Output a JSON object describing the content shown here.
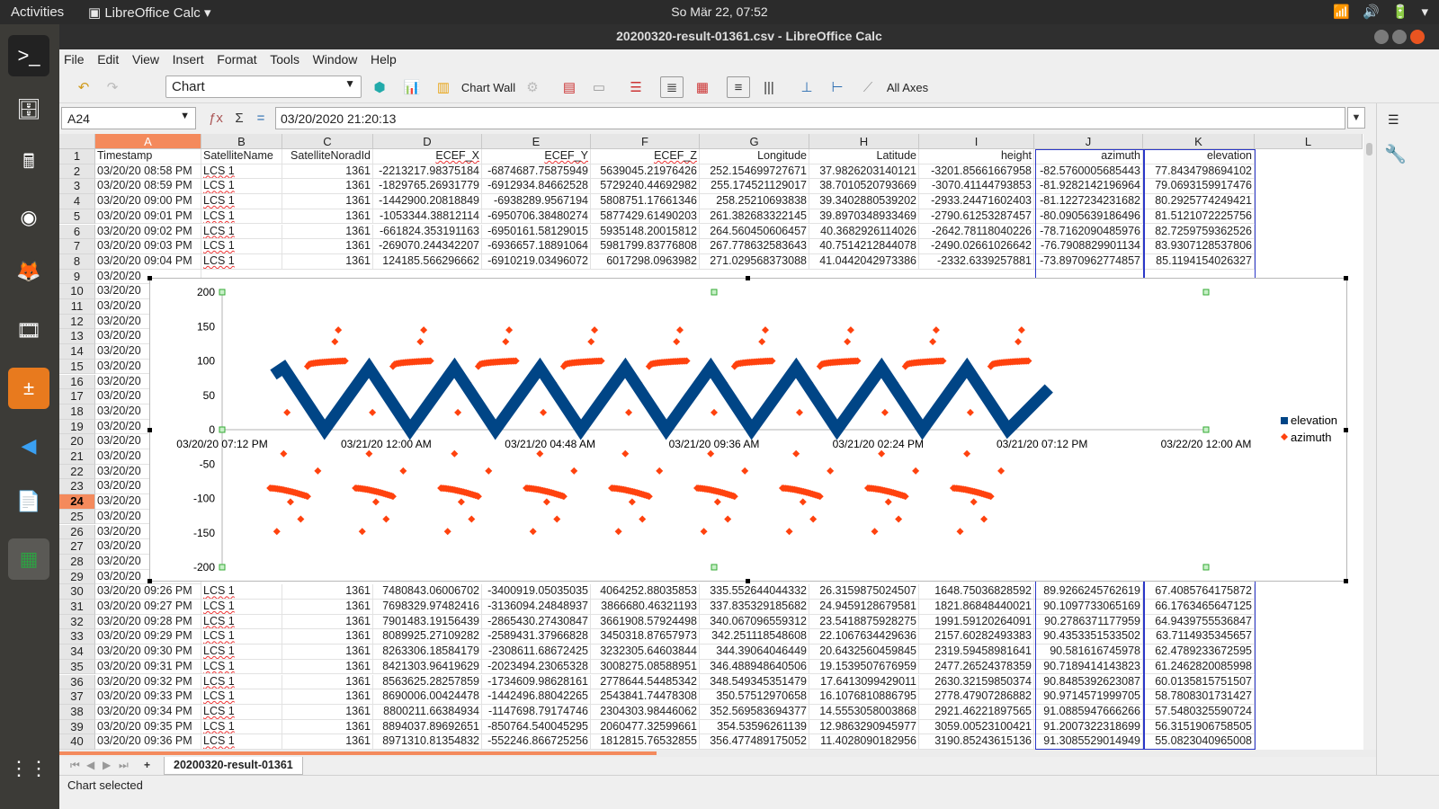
{
  "topbar": {
    "activities": "Activities",
    "app_name": "LibreOffice Calc",
    "clock": "So Mär 22, 07:52"
  },
  "window": {
    "title": "20200320-result-01361.csv - LibreOffice Calc"
  },
  "menu": [
    "File",
    "Edit",
    "View",
    "Insert",
    "Format",
    "Tools",
    "Window",
    "Help"
  ],
  "toolbar": {
    "chart_selector": "Chart",
    "chart_wall_label": "Chart Wall",
    "all_axes_label": "All Axes"
  },
  "formula": {
    "name_box": "A24",
    "content": "03/20/2020 21:20:13"
  },
  "columns": [
    "A",
    "B",
    "C",
    "D",
    "E",
    "F",
    "G",
    "H",
    "I",
    "J",
    "K",
    "L"
  ],
  "visible_rows": [
    1,
    2,
    3,
    4,
    5,
    6,
    7,
    8,
    9,
    10,
    11,
    12,
    13,
    14,
    15,
    16,
    17,
    18,
    19,
    20,
    21,
    22,
    23,
    24,
    25,
    26,
    27,
    28,
    29,
    30,
    31,
    32,
    33,
    34,
    35,
    36,
    37,
    38,
    39,
    40
  ],
  "headers": [
    "Timestamp",
    "SatelliteName",
    "SatelliteNoradId",
    "ECEF_X",
    "ECEF_Y",
    "ECEF_Z",
    "Longitude",
    "Latitude",
    "height",
    "azimuth",
    "elevation"
  ],
  "rows_top": [
    [
      "03/20/20 08:58 PM",
      "LCS 1",
      "1361",
      "-2213217.98375184",
      "-6874687.75875949",
      "5639045.21976426",
      "252.154699727671",
      "37.9826203140121",
      "-3201.85661667958",
      "-82.5760005685443",
      "77.8434798694102"
    ],
    [
      "03/20/20 08:59 PM",
      "LCS 1",
      "1361",
      "-1829765.26931779",
      "-6912934.84662528",
      "5729240.44692982",
      "255.174521129017",
      "38.7010520793669",
      "-3070.41144793853",
      "-81.9282142196964",
      "79.0693159917476"
    ],
    [
      "03/20/20 09:00 PM",
      "LCS 1",
      "1361",
      "-1442900.20818849",
      "-6938289.9567194",
      "5808751.17661346",
      "258.25210693838",
      "39.3402880539202",
      "-2933.24471602403",
      "-81.1227234231682",
      "80.2925774249421"
    ],
    [
      "03/20/20 09:01 PM",
      "LCS 1",
      "1361",
      "-1053344.38812114",
      "-6950706.38480274",
      "5877429.61490203",
      "261.382683322145",
      "39.8970348933469",
      "-2790.61253287457",
      "-80.0905639186496",
      "81.5121072225756"
    ],
    [
      "03/20/20 09:02 PM",
      "LCS 1",
      "1361",
      "-661824.353191163",
      "-6950161.58129015",
      "5935148.20015812",
      "264.560450606457",
      "40.3682926114026",
      "-2642.78118040226",
      "-78.7162090485976",
      "82.7259759362526"
    ],
    [
      "03/20/20 09:03 PM",
      "LCS 1",
      "1361",
      "-269070.244342207",
      "-6936657.18891064",
      "5981799.83776808",
      "267.778632583643",
      "40.7514212844078",
      "-2490.02661026642",
      "-76.7908829901134",
      "83.9307128537806"
    ],
    [
      "03/20/20 09:04 PM",
      "LCS 1",
      "1361",
      "124185.566296662",
      "-6910219.03496072",
      "6017298.0963982",
      "271.029568373088",
      "41.0442042973386",
      "-2332.6339257881",
      "-73.8970962774857",
      "85.1194154026327"
    ]
  ],
  "rows_hidden_timestamps": [
    "03/20/20",
    "03/20/20",
    "03/20/20",
    "03/20/20",
    "03/20/20",
    "03/20/20",
    "03/20/20",
    "03/20/20",
    "03/20/20",
    "03/20/20",
    "03/20/20",
    "03/20/20",
    "03/20/20",
    "03/20/20",
    "03/20/20",
    "03/20/20",
    "03/20/20",
    "03/20/20",
    "03/20/20",
    "03/20/20",
    "03/20/20"
  ],
  "rows_bottom": [
    [
      "03/20/20 09:26 PM",
      "LCS 1",
      "1361",
      "7480843.06006702",
      "-3400919.05035035",
      "4064252.88035853",
      "335.552644044332",
      "26.3159875024507",
      "1648.75036828592",
      "89.9266245762619",
      "67.4085764175872"
    ],
    [
      "03/20/20 09:27 PM",
      "LCS 1",
      "1361",
      "7698329.97482416",
      "-3136094.24848937",
      "3866680.46321193",
      "337.835329185682",
      "24.9459128679581",
      "1821.86848440021",
      "90.1097733065169",
      "66.1763465647125"
    ],
    [
      "03/20/20 09:28 PM",
      "LCS 1",
      "1361",
      "7901483.19156439",
      "-2865430.27430847",
      "3661908.57924498",
      "340.067096559312",
      "23.5418875928275",
      "1991.59120264091",
      "90.2786371177959",
      "64.9439755536847"
    ],
    [
      "03/20/20 09:29 PM",
      "LCS 1",
      "1361",
      "8089925.27109282",
      "-2589431.37966828",
      "3450318.87657973",
      "342.251118548608",
      "22.1067634429636",
      "2157.60282493383",
      "90.4353351533502",
      "63.7114935345657"
    ],
    [
      "03/20/20 09:30 PM",
      "LCS 1",
      "1361",
      "8263306.18584179",
      "-2308611.68672425",
      "3232305.64603844",
      "344.39064046449",
      "20.6432560459845",
      "2319.59458981641",
      "90.581616745978",
      "62.4789233672595"
    ],
    [
      "03/20/20 09:31 PM",
      "LCS 1",
      "1361",
      "8421303.96419629",
      "-2023494.23065328",
      "3008275.08588951",
      "346.488948640506",
      "19.1539507676959",
      "2477.26524378359",
      "90.7189414143823",
      "61.2462820085998"
    ],
    [
      "03/20/20 09:32 PM",
      "LCS 1",
      "1361",
      "8563625.28257859",
      "-1734609.98628161",
      "2778644.54485342",
      "348.549345351479",
      "17.6413099429011",
      "2630.32159850374",
      "90.8485392623087",
      "60.0135815751507"
    ],
    [
      "03/20/20 09:33 PM",
      "LCS 1",
      "1361",
      "8690006.00424478",
      "-1442496.88042265",
      "2543841.74478308",
      "350.57512970658",
      "16.1076810886795",
      "2778.47907286882",
      "90.9714571999705",
      "58.7808301731427"
    ],
    [
      "03/20/20 09:34 PM",
      "LCS 1",
      "1361",
      "8800211.66384934",
      "-1147698.79174746",
      "2304303.98446062",
      "352.569583694377",
      "14.5553058003868",
      "2921.46221897565",
      "91.0885947666266",
      "57.5480325590724"
    ],
    [
      "03/20/20 09:35 PM",
      "LCS 1",
      "1361",
      "8894037.89692651",
      "-850764.540045295",
      "2060477.32599661",
      "354.53596261139",
      "12.9863290945977",
      "3059.00523100421",
      "91.2007322318699",
      "56.3151906758505"
    ],
    [
      "03/20/20 09:36 PM",
      "LCS 1",
      "1361",
      "8971310.81354832",
      "-552246.866725256",
      "1812815.76532855",
      "356.477489175052",
      "11.4028090182956",
      "3190.85243615136",
      "91.3085529014949",
      "55.0823040965008"
    ]
  ],
  "chart_data": {
    "type": "scatter",
    "x_tick_labels": [
      "03/20/20 07:12 PM",
      "03/21/20 12:00 AM",
      "03/21/20 04:48 AM",
      "03/21/20 09:36 AM",
      "03/21/20 02:24 PM",
      "03/21/20 07:12 PM",
      "03/22/20 12:00 AM"
    ],
    "x_range_hours": [
      0,
      28.8
    ],
    "ylim": [
      -200,
      200
    ],
    "y_ticks": [
      200,
      150,
      100,
      50,
      0,
      -50,
      -100,
      -150,
      -200
    ],
    "series": [
      {
        "name": "elevation",
        "color": "#004586",
        "marker": "square",
        "description_points": "zigzag between ~0 and ~90 each pass",
        "peaks_hours": [
          1.8,
          4.3,
          6.8,
          9.3,
          11.8,
          14.3,
          16.8,
          19.3,
          21.8
        ],
        "troughs_hours": [
          3.0,
          5.5,
          8.0,
          10.5,
          13.0,
          15.5,
          18.0,
          20.5,
          23.0
        ],
        "start_hours": 1.5,
        "end_hours": 24.2,
        "end_value": 60
      },
      {
        "name": "azimuth",
        "color": "#ff420e",
        "marker": "diamond",
        "arc_centers_hours": [
          2.5,
          5.0,
          7.5,
          10.0,
          12.5,
          15.0,
          17.5,
          20.0,
          22.5
        ],
        "upper_plateau": 100,
        "lower_plateau": -85
      }
    ],
    "legend_position": "right"
  },
  "sheet_tab": "20200320-result-01361",
  "status": "Chart selected"
}
